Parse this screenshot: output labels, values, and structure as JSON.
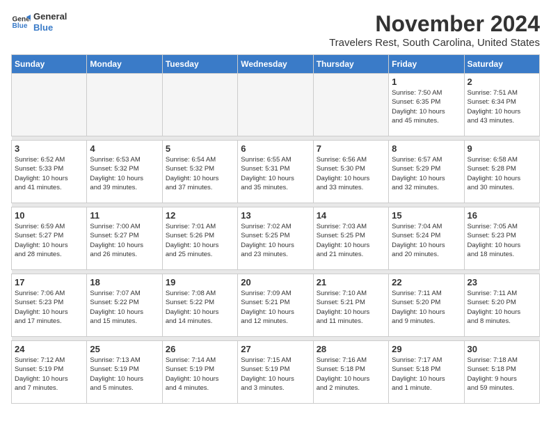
{
  "logo": {
    "line1": "General",
    "line2": "Blue"
  },
  "title": "November 2024",
  "subtitle": "Travelers Rest, South Carolina, United States",
  "weekdays": [
    "Sunday",
    "Monday",
    "Tuesday",
    "Wednesday",
    "Thursday",
    "Friday",
    "Saturday"
  ],
  "weeks": [
    [
      {
        "day": "",
        "info": ""
      },
      {
        "day": "",
        "info": ""
      },
      {
        "day": "",
        "info": ""
      },
      {
        "day": "",
        "info": ""
      },
      {
        "day": "",
        "info": ""
      },
      {
        "day": "1",
        "info": "Sunrise: 7:50 AM\nSunset: 6:35 PM\nDaylight: 10 hours\nand 45 minutes."
      },
      {
        "day": "2",
        "info": "Sunrise: 7:51 AM\nSunset: 6:34 PM\nDaylight: 10 hours\nand 43 minutes."
      }
    ],
    [
      {
        "day": "3",
        "info": "Sunrise: 6:52 AM\nSunset: 5:33 PM\nDaylight: 10 hours\nand 41 minutes."
      },
      {
        "day": "4",
        "info": "Sunrise: 6:53 AM\nSunset: 5:32 PM\nDaylight: 10 hours\nand 39 minutes."
      },
      {
        "day": "5",
        "info": "Sunrise: 6:54 AM\nSunset: 5:32 PM\nDaylight: 10 hours\nand 37 minutes."
      },
      {
        "day": "6",
        "info": "Sunrise: 6:55 AM\nSunset: 5:31 PM\nDaylight: 10 hours\nand 35 minutes."
      },
      {
        "day": "7",
        "info": "Sunrise: 6:56 AM\nSunset: 5:30 PM\nDaylight: 10 hours\nand 33 minutes."
      },
      {
        "day": "8",
        "info": "Sunrise: 6:57 AM\nSunset: 5:29 PM\nDaylight: 10 hours\nand 32 minutes."
      },
      {
        "day": "9",
        "info": "Sunrise: 6:58 AM\nSunset: 5:28 PM\nDaylight: 10 hours\nand 30 minutes."
      }
    ],
    [
      {
        "day": "10",
        "info": "Sunrise: 6:59 AM\nSunset: 5:27 PM\nDaylight: 10 hours\nand 28 minutes."
      },
      {
        "day": "11",
        "info": "Sunrise: 7:00 AM\nSunset: 5:27 PM\nDaylight: 10 hours\nand 26 minutes."
      },
      {
        "day": "12",
        "info": "Sunrise: 7:01 AM\nSunset: 5:26 PM\nDaylight: 10 hours\nand 25 minutes."
      },
      {
        "day": "13",
        "info": "Sunrise: 7:02 AM\nSunset: 5:25 PM\nDaylight: 10 hours\nand 23 minutes."
      },
      {
        "day": "14",
        "info": "Sunrise: 7:03 AM\nSunset: 5:25 PM\nDaylight: 10 hours\nand 21 minutes."
      },
      {
        "day": "15",
        "info": "Sunrise: 7:04 AM\nSunset: 5:24 PM\nDaylight: 10 hours\nand 20 minutes."
      },
      {
        "day": "16",
        "info": "Sunrise: 7:05 AM\nSunset: 5:23 PM\nDaylight: 10 hours\nand 18 minutes."
      }
    ],
    [
      {
        "day": "17",
        "info": "Sunrise: 7:06 AM\nSunset: 5:23 PM\nDaylight: 10 hours\nand 17 minutes."
      },
      {
        "day": "18",
        "info": "Sunrise: 7:07 AM\nSunset: 5:22 PM\nDaylight: 10 hours\nand 15 minutes."
      },
      {
        "day": "19",
        "info": "Sunrise: 7:08 AM\nSunset: 5:22 PM\nDaylight: 10 hours\nand 14 minutes."
      },
      {
        "day": "20",
        "info": "Sunrise: 7:09 AM\nSunset: 5:21 PM\nDaylight: 10 hours\nand 12 minutes."
      },
      {
        "day": "21",
        "info": "Sunrise: 7:10 AM\nSunset: 5:21 PM\nDaylight: 10 hours\nand 11 minutes."
      },
      {
        "day": "22",
        "info": "Sunrise: 7:11 AM\nSunset: 5:20 PM\nDaylight: 10 hours\nand 9 minutes."
      },
      {
        "day": "23",
        "info": "Sunrise: 7:11 AM\nSunset: 5:20 PM\nDaylight: 10 hours\nand 8 minutes."
      }
    ],
    [
      {
        "day": "24",
        "info": "Sunrise: 7:12 AM\nSunset: 5:19 PM\nDaylight: 10 hours\nand 7 minutes."
      },
      {
        "day": "25",
        "info": "Sunrise: 7:13 AM\nSunset: 5:19 PM\nDaylight: 10 hours\nand 5 minutes."
      },
      {
        "day": "26",
        "info": "Sunrise: 7:14 AM\nSunset: 5:19 PM\nDaylight: 10 hours\nand 4 minutes."
      },
      {
        "day": "27",
        "info": "Sunrise: 7:15 AM\nSunset: 5:19 PM\nDaylight: 10 hours\nand 3 minutes."
      },
      {
        "day": "28",
        "info": "Sunrise: 7:16 AM\nSunset: 5:18 PM\nDaylight: 10 hours\nand 2 minutes."
      },
      {
        "day": "29",
        "info": "Sunrise: 7:17 AM\nSunset: 5:18 PM\nDaylight: 10 hours\nand 1 minute."
      },
      {
        "day": "30",
        "info": "Sunrise: 7:18 AM\nSunset: 5:18 PM\nDaylight: 9 hours\nand 59 minutes."
      }
    ]
  ]
}
